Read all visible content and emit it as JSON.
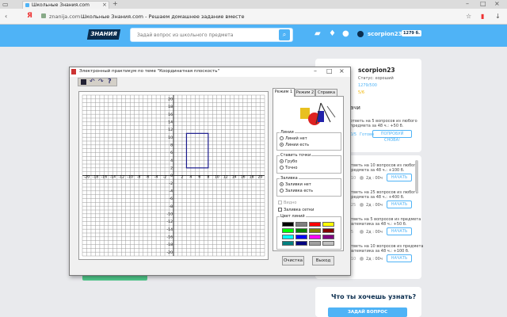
{
  "browser": {
    "tab_title": "Школьные Знания.com",
    "url_domain": "znanija.com",
    "page_title": "Школьные Знания.com - Решаем домашнее задание вместе",
    "yandex_logo": "Я"
  },
  "site": {
    "logo": "ЗНАНИЯ",
    "search_placeholder": "Задай вопрос из школьного предмета",
    "username": "scorpion23",
    "points_badge": "1279 б."
  },
  "profile": {
    "name": "scorpion23",
    "status": "Статус: хороший",
    "points": "1279/500",
    "extra": "5/6",
    "tasks_label": "ачи",
    "task_main_1": "ответь на 5 вопросов из любого",
    "task_main_2": "предмета за 48 ч.: +50 б.",
    "task_main_progress": "0/5",
    "task_main_left": "Готово",
    "retry_button": "ПОПРОБУЙ СНОВА!"
  },
  "tasks": [
    {
      "text1": "ответь на 10 вопросов из любого",
      "text2": "предмета за 48 ч.: +100 б.",
      "progress": "0/10",
      "time": "2д : 00ч",
      "button": "НАЧАТЬ"
    },
    {
      "text1": "ответь на 25 вопросов из любого",
      "text2": "предмета за 48 ч.: +400 б.",
      "progress": "0/25",
      "time": "2д : 00ч",
      "button": "НАЧАТЬ"
    },
    {
      "text1": "ответь на 5 вопросов из предмета",
      "text2": "математика за 48 ч.: +50 б.",
      "progress": "0/5",
      "time": "2д : 00ч",
      "button": "НАЧАТЬ"
    },
    {
      "text1": "ответь на 10 вопросов из предмета",
      "text2": "математика за 48 ч.: +100 б.",
      "progress": "0/10",
      "time": "2д : 00ч",
      "button": "НАЧАТЬ"
    }
  ],
  "ask": {
    "title": "Что ты хочешь узнать?",
    "button": "ЗАДАЙ ВОПРОС"
  },
  "dialog": {
    "title": "Электронный практикум по теме \"Координатная плоскость\"",
    "tabs": [
      "Режим 1",
      "Режим 2",
      "Справка"
    ],
    "lines_group": {
      "title": "Линии",
      "options": [
        "Линий нет",
        "Линии есть"
      ],
      "selected": 1
    },
    "points_group": {
      "title": "Ставить точки",
      "options": [
        "Грубо",
        "Точно"
      ],
      "selected": 0
    },
    "fill_group": {
      "title": "Заливка",
      "options": [
        "Заливки нет",
        "Заливка есть"
      ],
      "selected": 0
    },
    "checkbox_visible": "Видно",
    "checkbox_grid_fill": "Заливка сетки",
    "colors_title": "Цвет линий",
    "clear_button": "Очистка",
    "exit_button": "Выход"
  },
  "chart_data": {
    "type": "scatter",
    "x_ticks": [
      "-20",
      "-18",
      "-16",
      "-14",
      "-12",
      "-10",
      "-8",
      "-6",
      "-4",
      "-2",
      "0",
      "2",
      "4",
      "6",
      "8",
      "10",
      "12",
      "14",
      "16",
      "18",
      "20"
    ],
    "y_ticks": [
      "20",
      "18",
      "16",
      "14",
      "12",
      "10",
      "8",
      "6",
      "4",
      "2",
      "0",
      "-2",
      "-4",
      "-6",
      "-8",
      "-10",
      "-12",
      "-14",
      "-16",
      "-18",
      "-20"
    ],
    "xlim": [
      -21,
      21
    ],
    "ylim": [
      -21,
      21
    ],
    "grid": true,
    "rectangle": {
      "x": [
        3,
        8
      ],
      "y": [
        2,
        11
      ],
      "color": "#1a1a8c"
    }
  },
  "colors": {
    "accent": "#4fb3f6",
    "palette": [
      "#000000",
      "#7f7f7f",
      "#ff0000",
      "#ffff00",
      "#00ff00",
      "#008000",
      "#808000",
      "#800000",
      "#00ffff",
      "#0000ff",
      "#ff00ff",
      "#800080",
      "#008080",
      "#000080",
      "#a0a0a0",
      "#c0c0c0"
    ]
  }
}
